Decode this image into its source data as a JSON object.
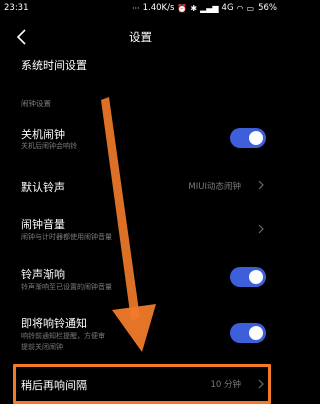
{
  "status_bar": {
    "time": "23:31",
    "speed": "1.40K/s",
    "network": "4G",
    "battery": "56%"
  },
  "header": {
    "title": "设置",
    "back_icon": "chevron-left-icon"
  },
  "rows": {
    "system_time": {
      "title": "系统时间设置"
    },
    "section": "闹钟设置",
    "shutdown_alarm": {
      "title": "关机闹钟",
      "subtitle": "关机后闹钟会响铃",
      "enabled": true
    },
    "default_ringtone": {
      "title": "默认铃声",
      "value": "MIUI动态闹钟"
    },
    "alarm_volume": {
      "title": "闹钟音量",
      "subtitle": "闹钟与计时器都使用闹钟音量"
    },
    "ringtone_fade": {
      "title": "铃声渐响",
      "subtitle": "铃声渐响至已设置的闹钟音量",
      "enabled": true
    },
    "upcoming_notify": {
      "title": "即将响铃通知",
      "subtitle_line1": "响铃前通知栏提醒，方便审",
      "subtitle_line2": "提前关闭闹钟",
      "enabled": true
    },
    "snooze_interval": {
      "title": "稍后再响间隔",
      "value": "10 分钟"
    }
  },
  "colors": {
    "toggle_on": "#3d5fd9",
    "annotation": "#f07a2a"
  }
}
